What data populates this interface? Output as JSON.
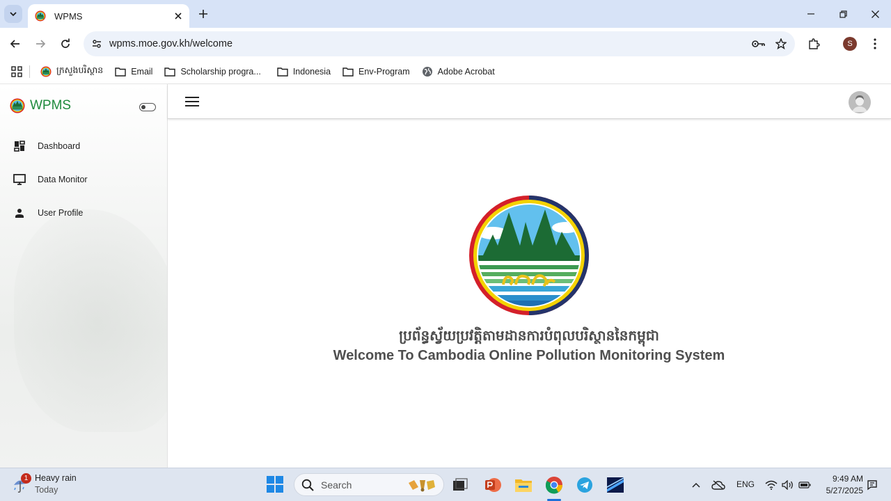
{
  "browser": {
    "tab_title": "WPMS",
    "url": "wpms.moe.gov.kh/welcome",
    "bookmarks": [
      {
        "label": "ក្រសួងបរិស្ថាន",
        "icon": "moe-logo-icon"
      },
      {
        "label": "Email",
        "icon": "folder-icon"
      },
      {
        "label": "Scholarship progra...",
        "icon": "folder-icon"
      },
      {
        "label": "Indonesia",
        "icon": "folder-icon"
      },
      {
        "label": "Env-Program",
        "icon": "folder-icon"
      },
      {
        "label": "Adobe Acrobat",
        "icon": "globe-icon"
      }
    ],
    "profile_initial": "S"
  },
  "app": {
    "brand": "WPMS",
    "menu": [
      {
        "label": "Dashboard",
        "icon": "dashboard-icon"
      },
      {
        "label": "Data Monitor",
        "icon": "monitor-icon"
      },
      {
        "label": "User Profile",
        "icon": "person-icon"
      }
    ],
    "welcome_kh": "ប្រព័ន្ធស្វ័យប្រវត្តិតាមដានការបំពុលបរិស្ថាននៃកម្ពុជា",
    "welcome_en": "Welcome To Cambodia Online Pollution Monitoring System",
    "colors": {
      "brand_green": "#1f8a3c",
      "logo_red": "#d4202a",
      "logo_yellow": "#f4d200",
      "logo_navy": "#24346b"
    }
  },
  "taskbar": {
    "weather_title": "Heavy rain",
    "weather_sub": "Today",
    "weather_badge": "1",
    "search_placeholder": "Search",
    "lang": "ENG",
    "time": "9:49 AM",
    "date": "5/27/2025"
  }
}
